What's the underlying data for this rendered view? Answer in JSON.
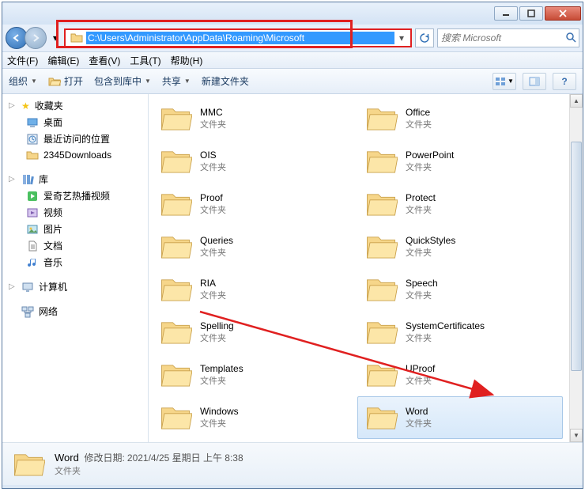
{
  "address_path": "C:\\Users\\Administrator\\AppData\\Roaming\\Microsoft",
  "search_placeholder": "搜索 Microsoft",
  "menu": {
    "file": "文件(F)",
    "edit": "编辑(E)",
    "view": "查看(V)",
    "tools": "工具(T)",
    "help": "帮助(H)"
  },
  "toolbar": {
    "organize": "组织",
    "open": "打开",
    "include": "包含到库中",
    "share": "共享",
    "newfolder": "新建文件夹"
  },
  "sidebar": {
    "favorites": {
      "label": "收藏夹",
      "items": [
        {
          "label": "桌面",
          "icon": "desktop"
        },
        {
          "label": "最近访问的位置",
          "icon": "recent"
        },
        {
          "label": "2345Downloads",
          "icon": "folder"
        }
      ]
    },
    "libraries": {
      "label": "库",
      "items": [
        {
          "label": "爱奇艺热播视频",
          "icon": "iqiyi"
        },
        {
          "label": "视频",
          "icon": "video"
        },
        {
          "label": "图片",
          "icon": "picture"
        },
        {
          "label": "文档",
          "icon": "document"
        },
        {
          "label": "音乐",
          "icon": "music"
        }
      ]
    },
    "computer": {
      "label": "计算机"
    },
    "network": {
      "label": "网络"
    }
  },
  "folder_type": "文件夹",
  "folders_left": [
    {
      "name": "MMC"
    },
    {
      "name": "OIS"
    },
    {
      "name": "Proof"
    },
    {
      "name": "Queries"
    },
    {
      "name": "RIA"
    },
    {
      "name": "Spelling"
    },
    {
      "name": "Templates"
    },
    {
      "name": "Windows"
    }
  ],
  "folders_right": [
    {
      "name": "Office"
    },
    {
      "name": "PowerPoint"
    },
    {
      "name": "Protect"
    },
    {
      "name": "QuickStyles"
    },
    {
      "name": "Speech"
    },
    {
      "name": "SystemCertificates"
    },
    {
      "name": "UProof"
    },
    {
      "name": "Word",
      "selected": true
    }
  ],
  "details": {
    "name": "Word",
    "modlabel": "修改日期:",
    "moddate": "2021/4/25 星期日 上午 8:38",
    "type": "文件夹"
  }
}
